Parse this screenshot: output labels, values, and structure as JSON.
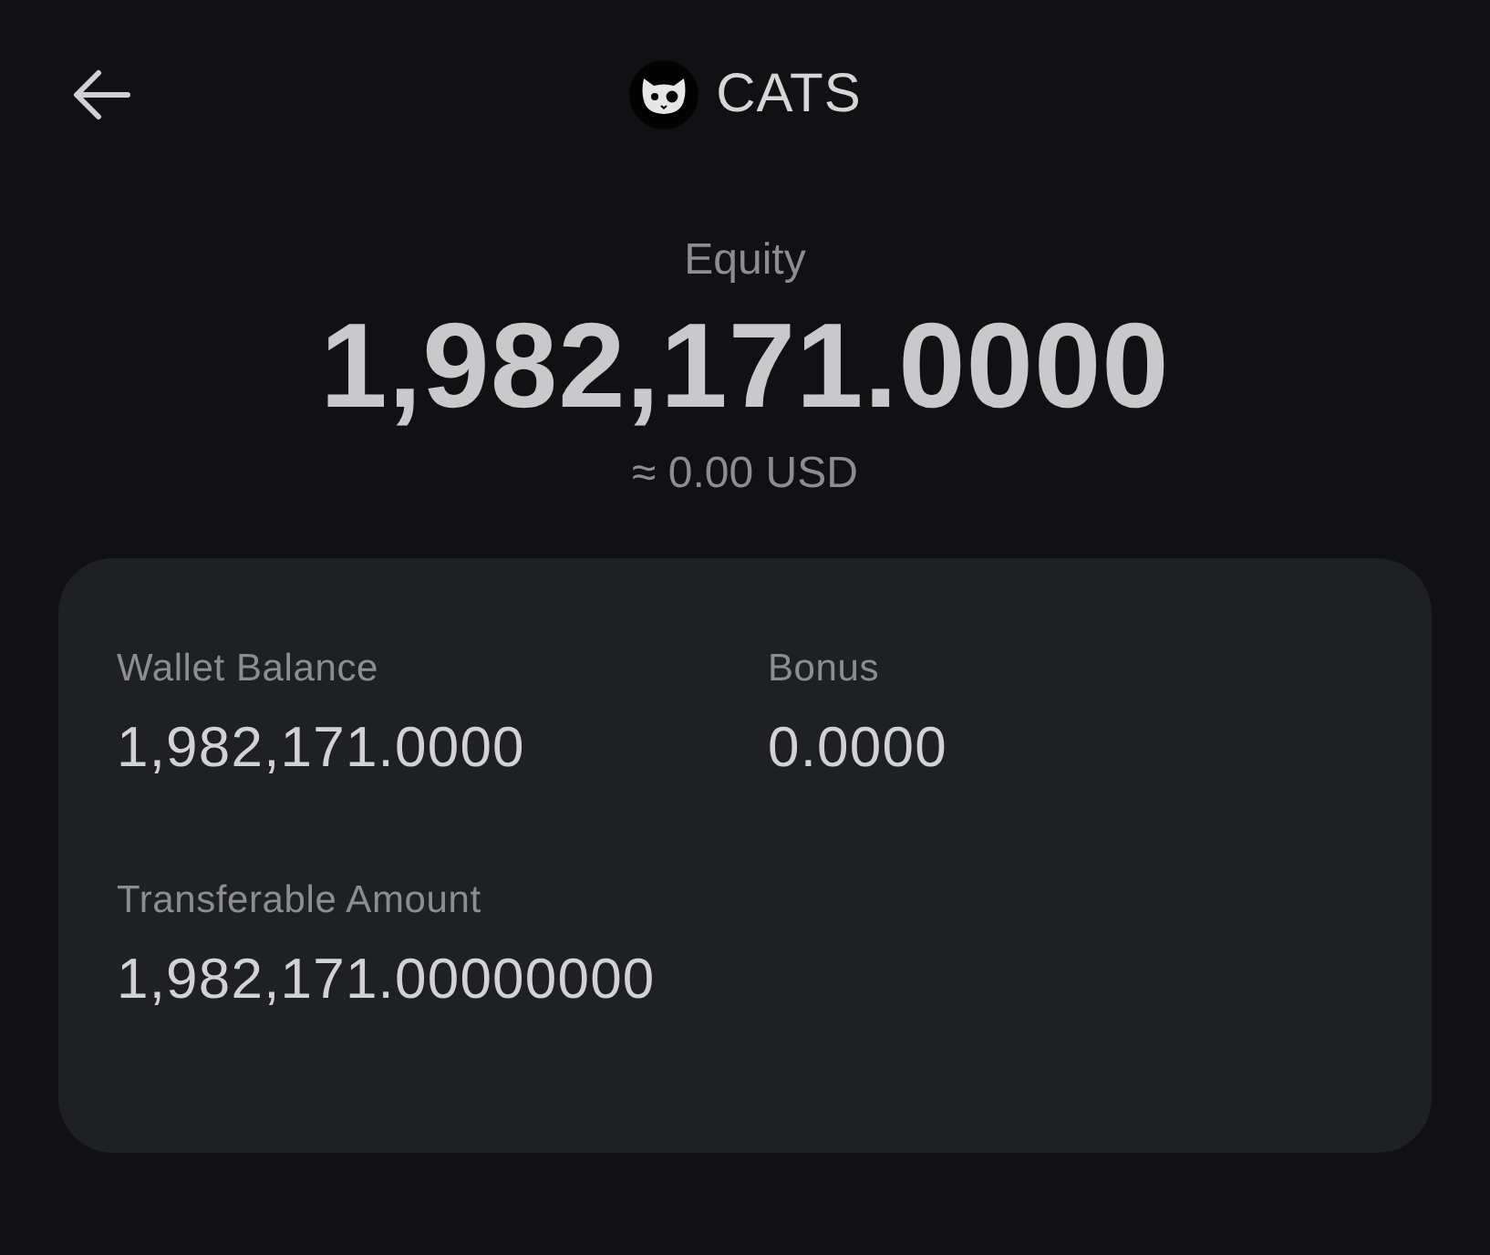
{
  "header": {
    "title": "CATS"
  },
  "equity": {
    "label": "Equity",
    "value": "1,982,171.0000",
    "converted": "≈ 0.00 USD"
  },
  "card": {
    "fields": [
      {
        "label": "Wallet Balance",
        "value": "1,982,171.0000"
      },
      {
        "label": "Bonus",
        "value": "0.0000"
      },
      {
        "label": "Transferable Amount",
        "value": "1,982,171.00000000"
      }
    ]
  }
}
